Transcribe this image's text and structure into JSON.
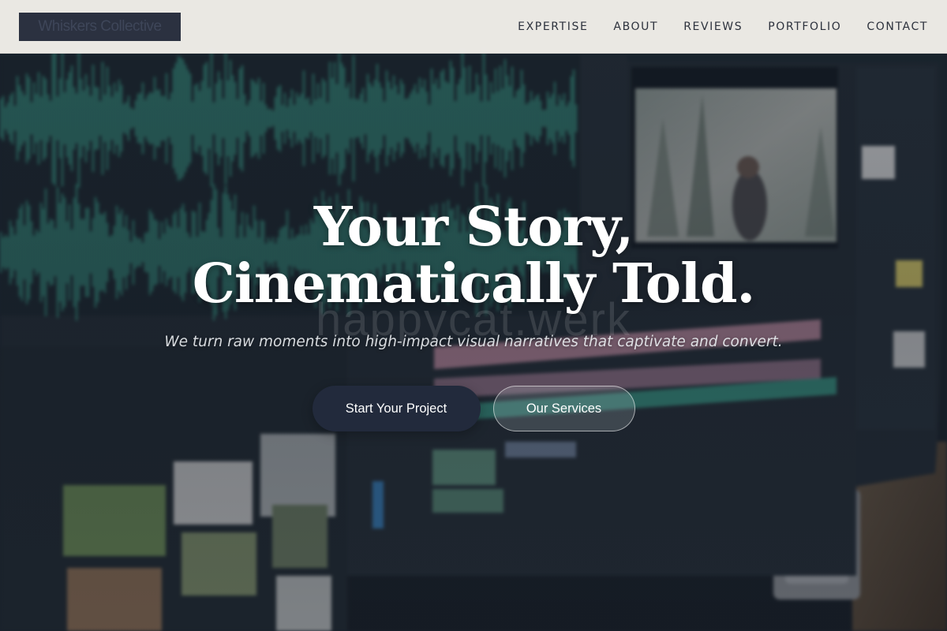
{
  "brand": {
    "name": "Whiskers Collective"
  },
  "nav": {
    "items": [
      {
        "label": "EXPERTISE"
      },
      {
        "label": "ABOUT"
      },
      {
        "label": "REVIEWS"
      },
      {
        "label": "PORTFOLIO"
      },
      {
        "label": "CONTACT"
      }
    ]
  },
  "hero": {
    "headline_line1": "Your Story,",
    "headline_line2": "Cinematically Told.",
    "watermark": "happycat.werk",
    "subtitle": "We turn raw moments into high-impact visual narratives that captivate and convert.",
    "primary_cta": "Start Your Project",
    "secondary_cta": "Our Services"
  },
  "colors": {
    "header_bg": "#f2f0eb",
    "logo_bg": "#2b3140",
    "primary_button": "#222a3c",
    "waveform": "#3fb59b",
    "timeline_pink": "#d79ab0"
  }
}
